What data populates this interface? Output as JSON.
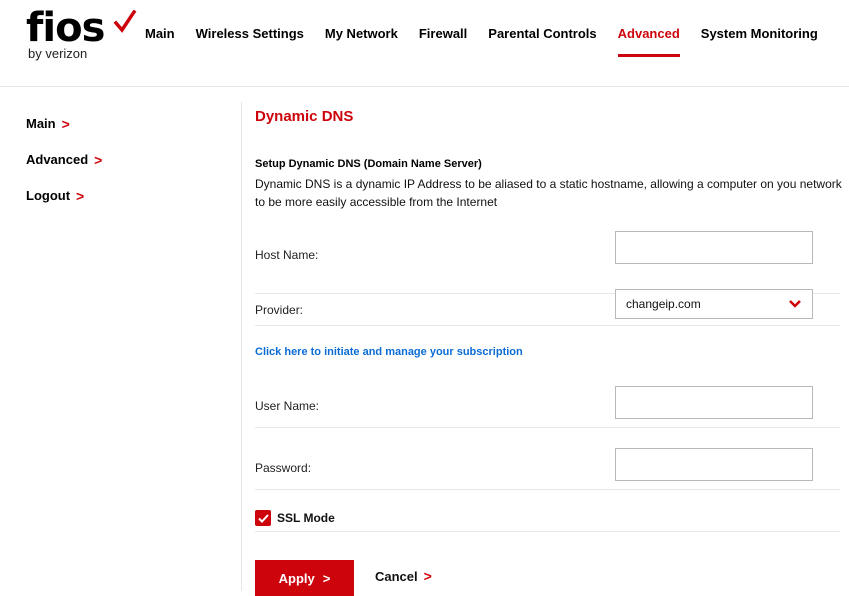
{
  "brand": {
    "name": "fios",
    "sub": "by verizon",
    "accent": "#cd040b"
  },
  "topnav": [
    {
      "label": "Main",
      "active": false
    },
    {
      "label": "Wireless Settings",
      "active": false
    },
    {
      "label": "My Network",
      "active": false
    },
    {
      "label": "Firewall",
      "active": false
    },
    {
      "label": "Parental Controls",
      "active": false
    },
    {
      "label": "Advanced",
      "active": true
    },
    {
      "label": "System Monitoring",
      "active": false
    }
  ],
  "sidenav": [
    {
      "label": "Main",
      "icon": "chevron-right-icon"
    },
    {
      "label": "Advanced",
      "icon": "chevron-right-icon"
    },
    {
      "label": "Logout",
      "icon": "chevron-right-icon"
    }
  ],
  "page": {
    "title": "Dynamic DNS",
    "setup_heading": "Setup Dynamic DNS (Domain Name Server)",
    "description": "Dynamic DNS is a dynamic IP Address to be aliased to a static hostname, allowing a computer on you network to be more easily accessible from the Internet"
  },
  "form": {
    "host_name": {
      "label": "Host Name:",
      "value": ""
    },
    "provider": {
      "label": "Provider:",
      "value": "changeip.com",
      "icon": "chevron-down-icon"
    },
    "subscription_link": "Click here to initiate and manage your subscription",
    "user_name": {
      "label": "User Name:",
      "value": ""
    },
    "password": {
      "label": "Password:",
      "value": ""
    },
    "ssl_mode": {
      "label": "SSL Mode",
      "checked": true
    }
  },
  "actions": {
    "apply": "Apply",
    "cancel": "Cancel"
  }
}
